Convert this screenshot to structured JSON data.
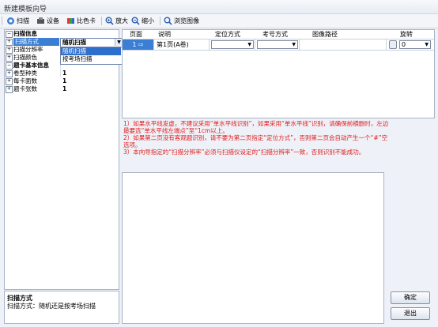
{
  "window": {
    "title": "新建模板向导"
  },
  "toolbar": {
    "scan": "扫描",
    "device": "设备",
    "color_card": "比色卡",
    "zoom_in": "放大",
    "zoom_out": "缩小",
    "browse": "浏览图像"
  },
  "properties": {
    "scan_info": "扫描信息",
    "scan_mode": "扫描方式",
    "scan_mode_value": "随机扫描",
    "scan_resolution": "扫描分辨率",
    "scan_color": "扫描颜色",
    "card_basic_info": "题卡基本信息",
    "volume_type": "卷型种类",
    "volume_type_value": "1",
    "pages_per_card": "每卡面数",
    "pages_per_card_value": "1",
    "card_sheets": "题卡张数",
    "card_sheets_value": "1",
    "dropdown_options": [
      "随机扫描",
      "按考场扫描"
    ]
  },
  "description": {
    "title": "扫描方式",
    "text": "扫描方式：随机还是按考场扫描"
  },
  "table": {
    "columns": [
      "页面",
      "说明",
      "定位方式",
      "考号方式",
      "图像路径",
      "旋转"
    ],
    "rows": [
      {
        "page": "1 ⇨",
        "desc": "第1页(A卷)",
        "locate": "",
        "exam_no": "",
        "path": "",
        "rotate": "0"
      }
    ]
  },
  "notes": [
    "1）如果水平线发虚，不建议采用“单水平线识别”，如果采用“单水平线”识别，请确保前横删时，左边",
    "最要选“单水平线左端点”至“1cm以上。",
    "2）如果第二页没有客观题识别，请不要为第二页指定“定位方式”，否则第二页会自动产生一个“#”空",
    "选项。",
    "3）本向导指定的“扫描分辨率”必须与扫描仪设定的“扫描分辨率”一致，否则识别不能成功。"
  ],
  "buttons": {
    "ok": "确定",
    "exit": "退出"
  },
  "colors": {
    "accent": "#3b7fd4",
    "note": "#e02020"
  }
}
